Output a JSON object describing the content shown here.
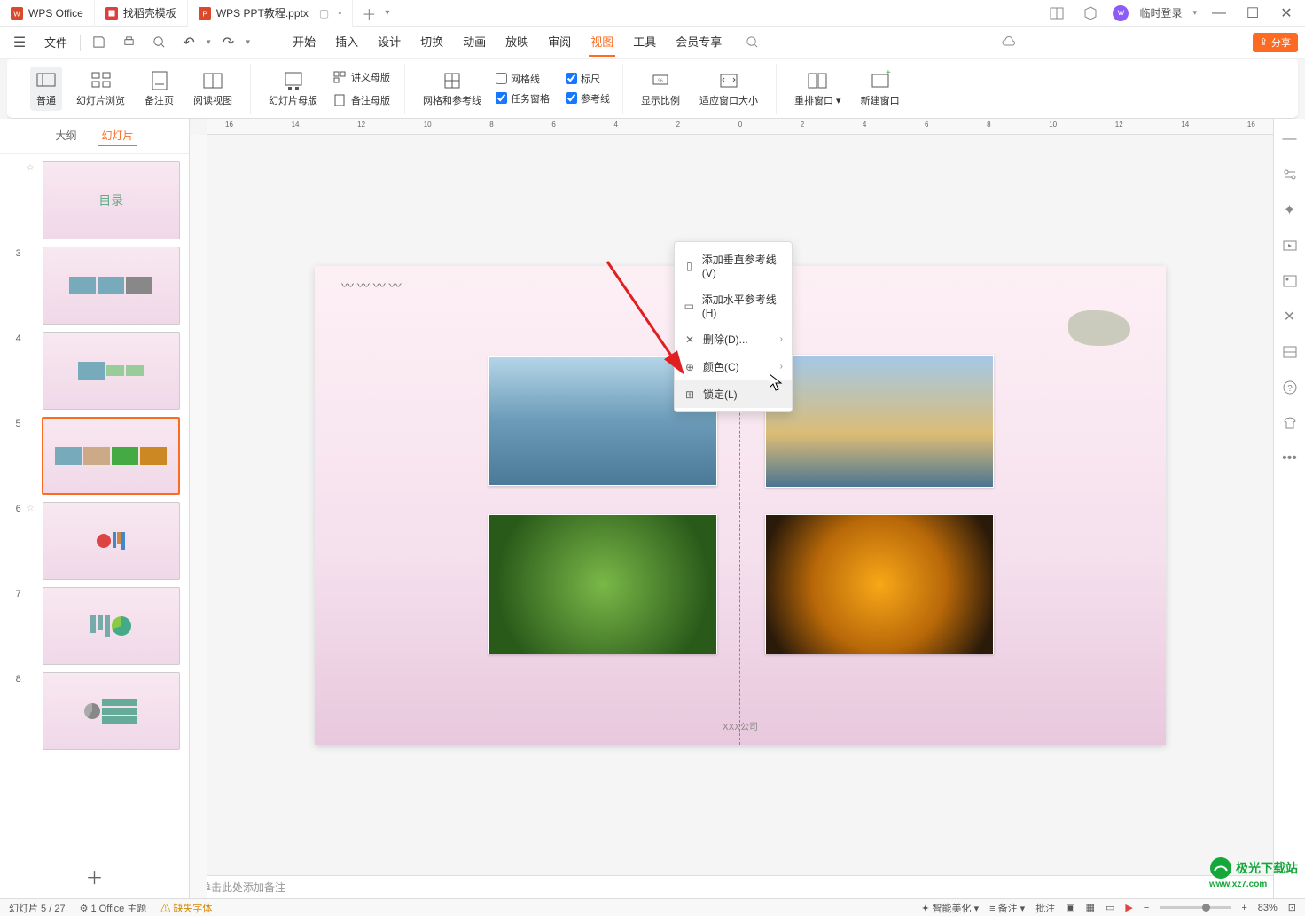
{
  "titlebar": {
    "tabs": [
      {
        "label": "WPS Office",
        "icon": "wps"
      },
      {
        "label": "找稻壳模板",
        "icon": "template"
      },
      {
        "label": "WPS PPT教程.pptx",
        "icon": "ppt",
        "active": true
      }
    ],
    "login": "临时登录"
  },
  "quickbar": {
    "file": "文件"
  },
  "menutabs": [
    "开始",
    "插入",
    "设计",
    "切换",
    "动画",
    "放映",
    "审阅",
    "视图",
    "工具",
    "会员专享"
  ],
  "menutab_active": "视图",
  "share": "分享",
  "ribbon": {
    "group1": [
      {
        "label": "普通",
        "active": true
      },
      {
        "label": "幻灯片浏览"
      },
      {
        "label": "备注页"
      },
      {
        "label": "阅读视图"
      }
    ],
    "group2": [
      {
        "label": "幻灯片母版"
      }
    ],
    "group2b": [
      {
        "label": "讲义母版"
      },
      {
        "label": "备注母版"
      }
    ],
    "group3": {
      "label": "网格和参考线"
    },
    "group3_checks": [
      {
        "label": "网格线",
        "checked": false
      },
      {
        "label": "任务窗格",
        "checked": true
      },
      {
        "label": "标尺",
        "checked": true
      },
      {
        "label": "参考线",
        "checked": true
      }
    ],
    "group4": [
      {
        "label": "显示比例"
      },
      {
        "label": "适应窗口大小"
      }
    ],
    "group5": [
      {
        "label": "重排窗口"
      },
      {
        "label": "新建窗口"
      }
    ]
  },
  "panel_tabs": {
    "outline": "大纲",
    "slides": "幻灯片"
  },
  "thumbs": [
    {
      "n": "",
      "star": true
    },
    {
      "n": "3"
    },
    {
      "n": "4"
    },
    {
      "n": "5",
      "selected": true
    },
    {
      "n": "6",
      "star": true
    },
    {
      "n": "7"
    },
    {
      "n": "8"
    }
  ],
  "slide": {
    "footer": "XXX公司"
  },
  "context_menu": [
    {
      "label": "添加垂直参考线(V)",
      "icon": "guide-v"
    },
    {
      "label": "添加水平参考线(H)",
      "icon": "guide-h"
    },
    {
      "label": "删除(D)...",
      "icon": "delete",
      "arrow": true
    },
    {
      "label": "颜色(C)",
      "icon": "color",
      "arrow": true
    },
    {
      "label": "锁定(L)",
      "icon": "lock",
      "hover": true
    }
  ],
  "notes_placeholder": "单击此处添加备注",
  "status": {
    "slide_pos": "幻灯片 5 / 27",
    "theme": "1 Office 主题",
    "missing": "缺失字体",
    "beautify": "智能美化",
    "notes": "备注",
    "notes_on": true,
    "comment": "批注",
    "zoom": "83%"
  },
  "watermark": {
    "name": "极光下载站",
    "url": "www.xz7.com"
  },
  "ruler_marks": [
    "16",
    "14",
    "12",
    "10",
    "8",
    "6",
    "4",
    "2",
    "0",
    "2",
    "4",
    "6",
    "8",
    "10",
    "12",
    "14",
    "16"
  ]
}
